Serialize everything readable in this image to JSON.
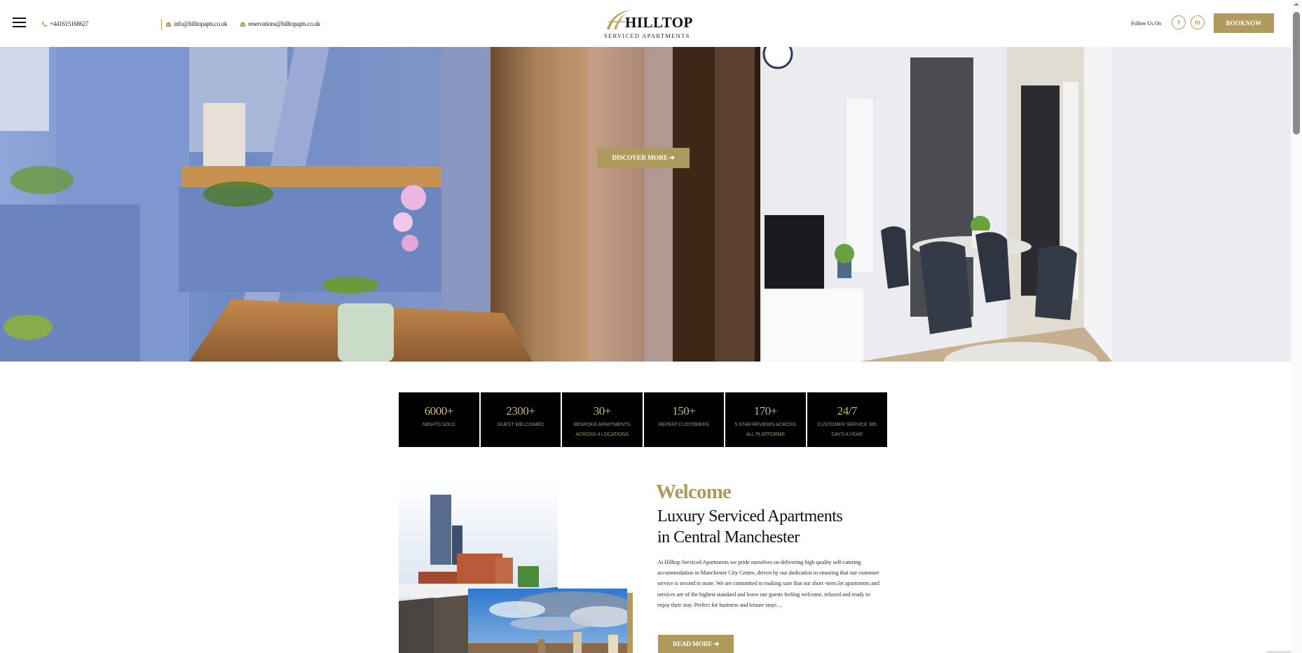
{
  "header": {
    "menu_icon": "hamburger-icon",
    "phone": "+441615168627",
    "phone_icon": "phone-icon",
    "email_info": "info@hilltopapts.co.uk",
    "email_reservations": "reservations@hilltopapts.co.uk",
    "email_icon": "envelope-icon",
    "logo": {
      "name": "HILLTOP",
      "tagline": "SERVICED APARTMENTS"
    },
    "follow_label": "Follow Us On",
    "social": [
      {
        "name": "facebook",
        "glyph": "f"
      },
      {
        "name": "linkedin",
        "glyph": "in"
      }
    ],
    "book_now_label": "BOOKNOW"
  },
  "hero": {
    "discover_label": "DISCOVER MORE ➔"
  },
  "stats": [
    {
      "value": "6000+",
      "label": "NIGHTS SOLD"
    },
    {
      "value": "2300+",
      "label": "GUEST WELCOMED"
    },
    {
      "value": "30+",
      "label": "BESPOKE APARTMENTS\nACROSS 4 LOCATIONS"
    },
    {
      "value": "150+",
      "label": "REPEAT CUSTOMERS"
    },
    {
      "value": "170+",
      "label": "5 STAR REVIEWS ACROSS\nALL PLATFORMS"
    },
    {
      "value": "24/7",
      "label": "CUSTOMER SERVICE 365\nDAYS A YEAR"
    }
  ],
  "welcome": {
    "title": "Welcome",
    "subtitle_line1": "Luxury Serviced Apartments",
    "subtitle_line2": "in Central Manchester",
    "body": "At Hilltop Serviced Apartments we pride ourselves on delivering high quality self-catering accommodation in Manchester City Centre, driven by our dedication to ensuring that our customer service is second to none. We are committed to making sure that our short -term let apartments and services are of the highest standard and leave our guests feeling welcome, relaxed and ready to enjoy their stay. Perfect for business and leisure stays ...",
    "read_more_label": "READ MORE ➔"
  },
  "colors": {
    "brand_gold": "#b09a5e",
    "stat_background": "#000000",
    "stat_text": "#c9b27c"
  }
}
